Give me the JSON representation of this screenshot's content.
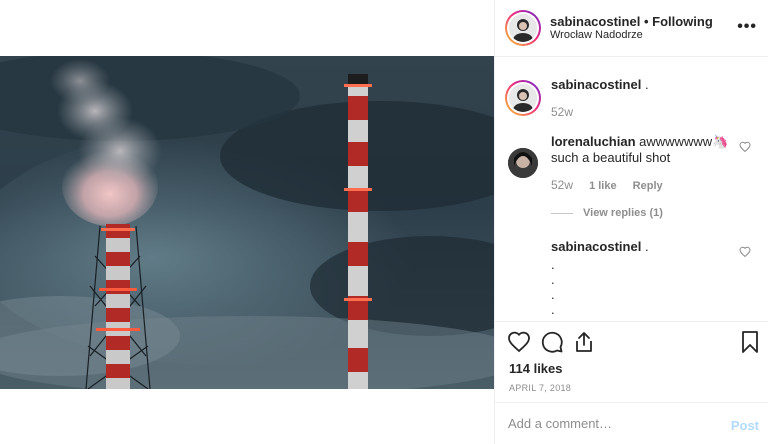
{
  "header": {
    "username": "sabinacostinel",
    "separator": "•",
    "follow_label": "Following",
    "location": "Wrocław Nadodrze",
    "more_icon": "more-horizontal-icon"
  },
  "comments": [
    {
      "username": "sabinacostinel",
      "text": ".",
      "age": "52w",
      "has_avatar_ring": true
    },
    {
      "username": "lorenaluchian",
      "text_line1": "awwwwwww🦄",
      "text_line2": "such a beautiful shot",
      "age": "52w",
      "likes": "1 like",
      "reply_label": "Reply",
      "view_replies": "View replies (1)"
    },
    {
      "username": "sabinacostinel",
      "text": ".",
      "dots": [
        ".",
        ".",
        ".",
        "."
      ]
    }
  ],
  "actions": {
    "like_icon": "heart-icon",
    "comment_icon": "comment-icon",
    "share_icon": "share-icon",
    "save_icon": "bookmark-icon"
  },
  "likes": "114 likes",
  "date": "APRIL 7, 2018",
  "add_comment": {
    "placeholder": "Add a comment…",
    "post_label": "Post"
  },
  "colors": {
    "text": "#262626",
    "muted": "#8e8e8e",
    "border": "#efefef",
    "post_disabled": "#b3dbff"
  }
}
